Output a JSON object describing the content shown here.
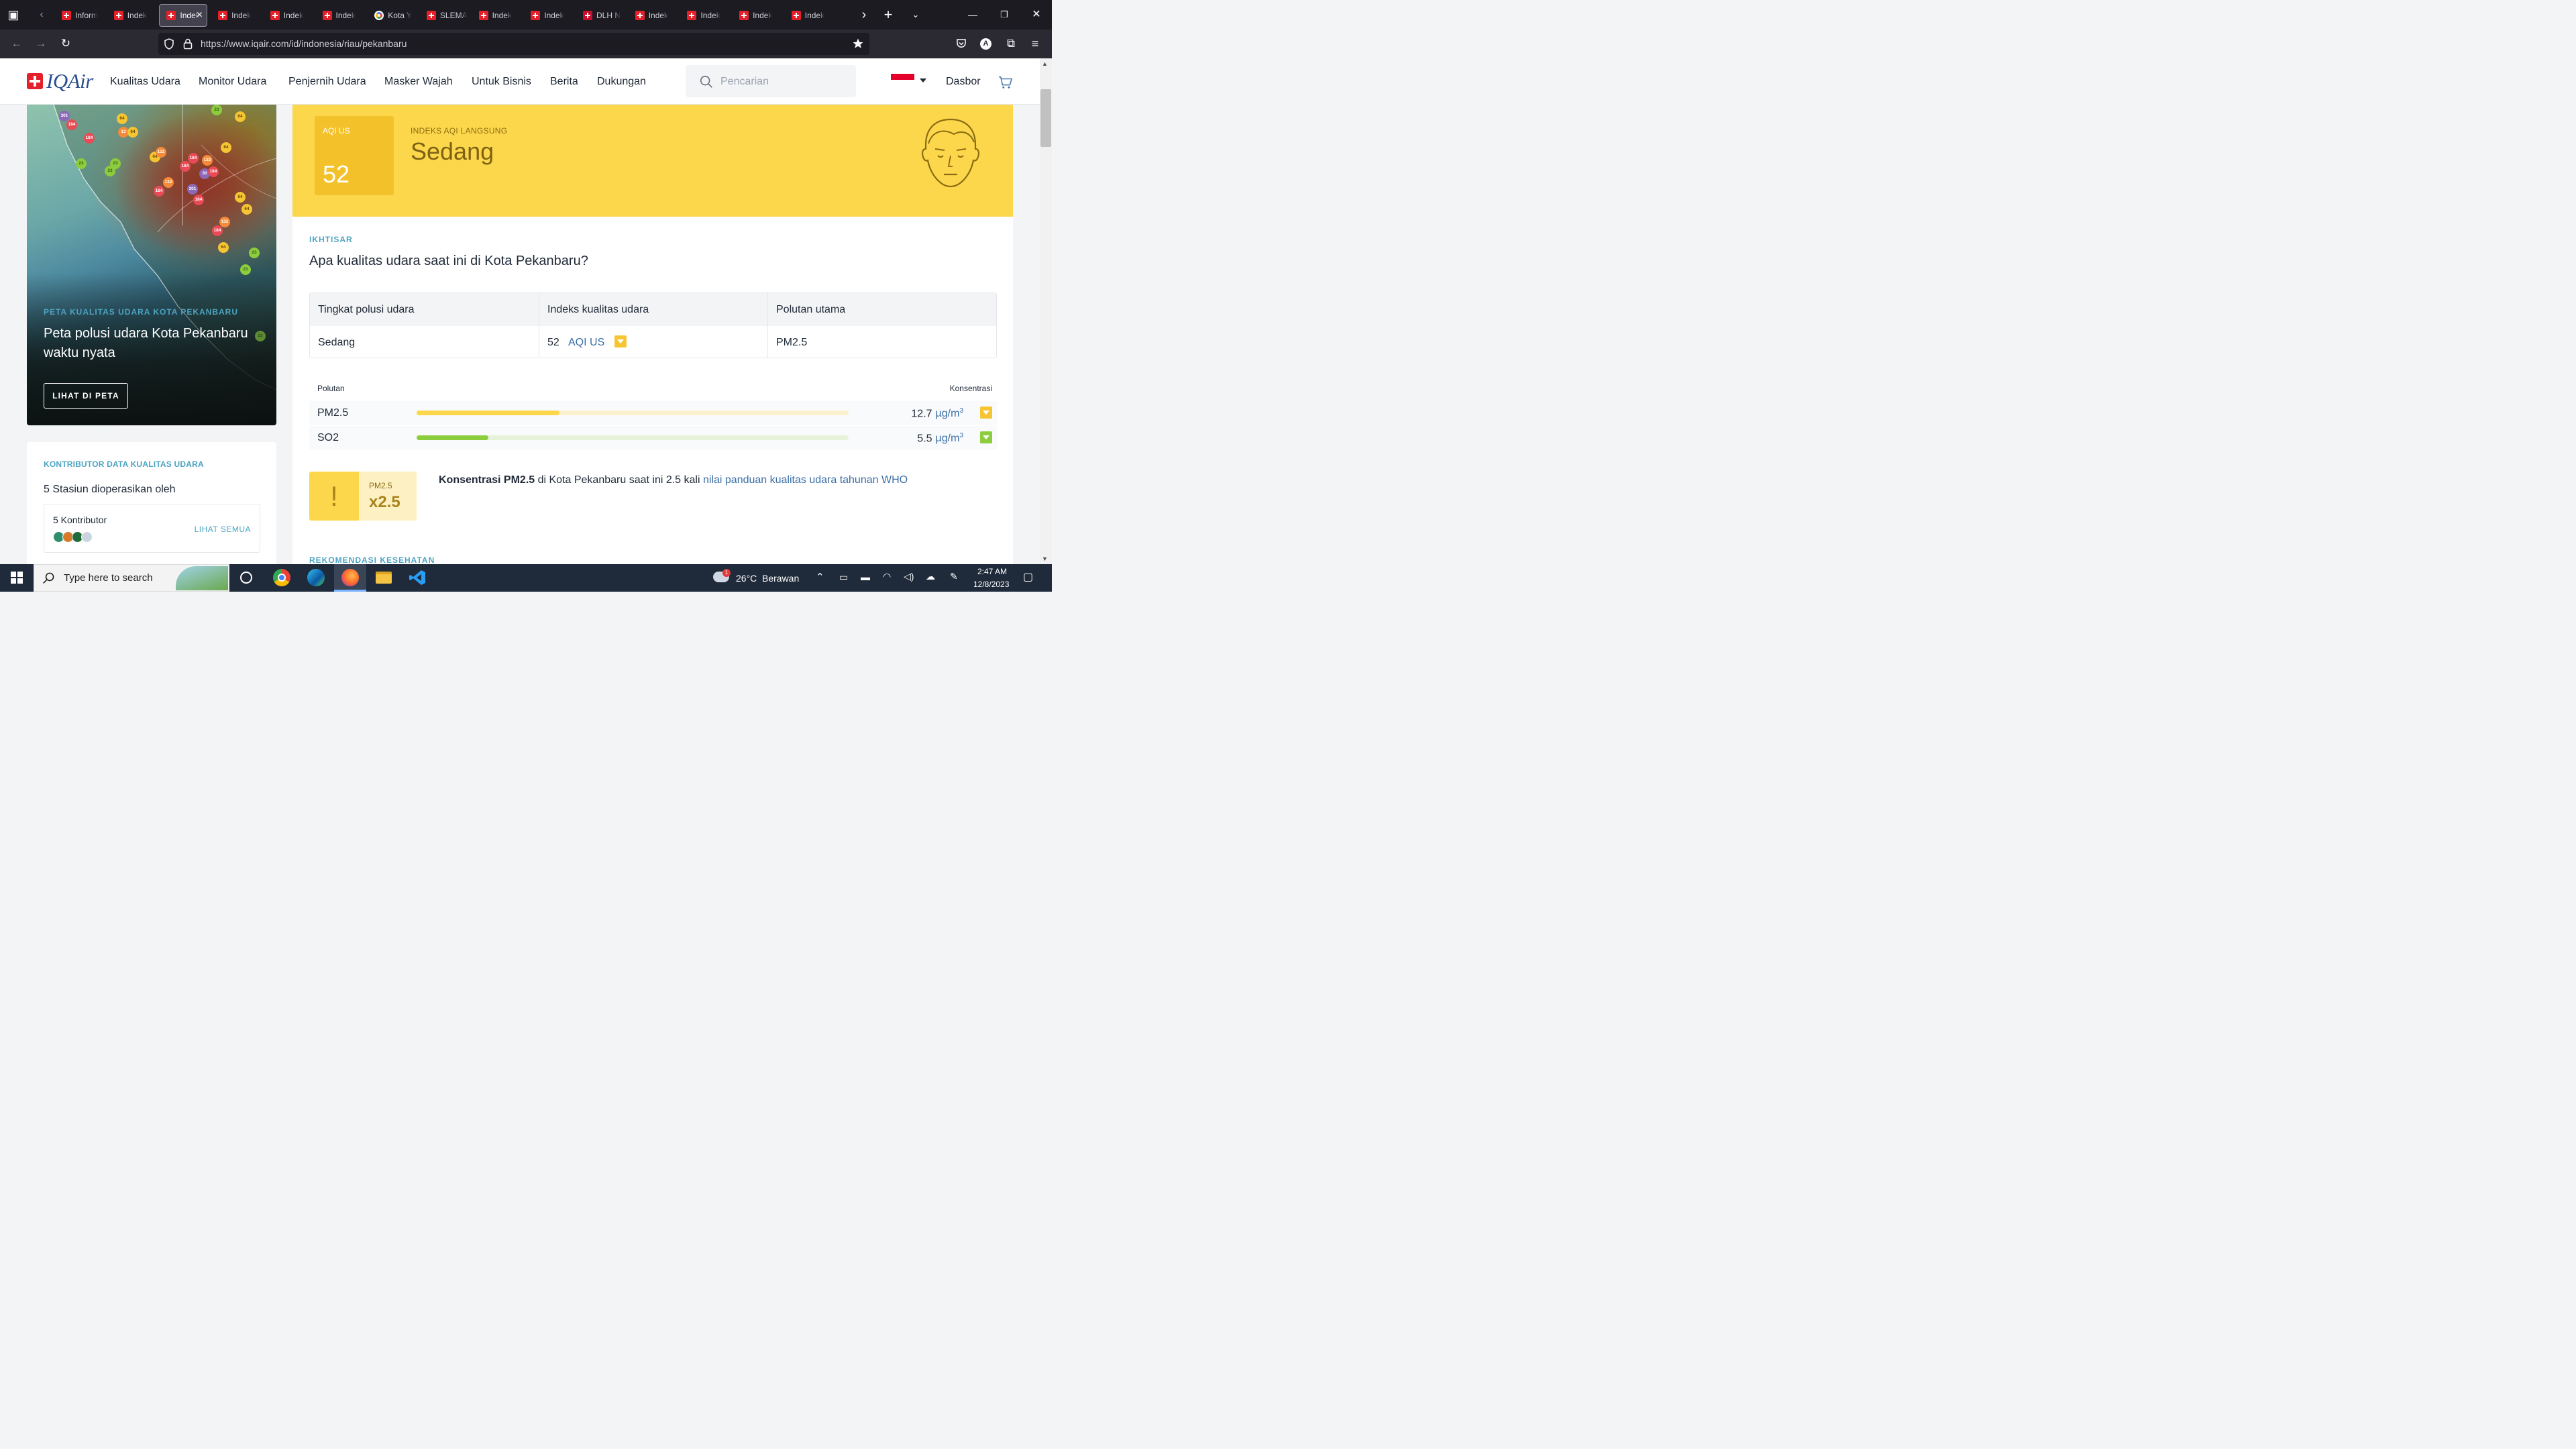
{
  "browser": {
    "tabs": [
      {
        "label": "Inform",
        "icon": "iqair-favicon"
      },
      {
        "label": "Indek",
        "icon": "iqair-favicon"
      },
      {
        "label": "Indek",
        "icon": "iqair-favicon",
        "active": true
      },
      {
        "label": "Indek",
        "icon": "iqair-favicon"
      },
      {
        "label": "Indek",
        "icon": "iqair-favicon"
      },
      {
        "label": "Indek",
        "icon": "iqair-favicon"
      },
      {
        "label": "Kota Y",
        "icon": "google-favicon"
      },
      {
        "label": "SLEMA",
        "icon": "iqair-favicon"
      },
      {
        "label": "Indek",
        "icon": "iqair-favicon"
      },
      {
        "label": "Indek",
        "icon": "iqair-favicon"
      },
      {
        "label": "DLH N",
        "icon": "dlh-favicon"
      },
      {
        "label": "Indek",
        "icon": "iqair-favicon"
      },
      {
        "label": "Indek",
        "icon": "iqair-favicon"
      },
      {
        "label": "Indek",
        "icon": "iqair-favicon"
      },
      {
        "label": "Indek",
        "icon": "iqair-favicon"
      }
    ],
    "url": "https://www.iqair.com/id/indonesia/riau/pekanbaru",
    "profile_initial": "A"
  },
  "site": {
    "logo_text": "IQAir",
    "nav": [
      "Kualitas Udara",
      "Monitor Udara",
      "Penjernih Udara",
      "Masker Wajah",
      "Untuk Bisnis",
      "Berita",
      "Dukungan"
    ],
    "search_placeholder": "Pencarian",
    "dashboard": "Dasbor"
  },
  "map_card": {
    "kicker": "PETA KUALITAS UDARA KOTA PEKANBARU",
    "title": "Peta polusi udara Kota Pekanbaru waktu nyata",
    "button": "LIHAT DI PETA",
    "markers": [
      "301",
      "184",
      "184",
      "64",
      "13",
      "64",
      "23",
      "64",
      "23",
      "23",
      "132",
      "64",
      "184",
      "184",
      "132",
      "64",
      "30",
      "184",
      "132",
      "184",
      "301",
      "184",
      "64",
      "64",
      "132",
      "184",
      "64",
      "23",
      "23",
      "23"
    ]
  },
  "contributors": {
    "kicker": "KONTRIBUTOR DATA KUALITAS UDARA",
    "operated_by": "5 Stasiun dioperasikan oleh",
    "count": "5 Kontributor",
    "see_all": "LIHAT SEMUA"
  },
  "aqi": {
    "label": "AQI US",
    "value": "52",
    "live_label": "INDEKS AQI LANGSUNG",
    "status": "Sedang",
    "color": "#fdd74b"
  },
  "overview": {
    "kicker": "IKHTISAR",
    "question": "Apa kualitas udara saat ini di Kota Pekanbaru?",
    "table": {
      "headers": [
        "Tingkat polusi udara",
        "Indeks kualitas udara",
        "Polutan utama"
      ],
      "level": "Sedang",
      "index_value": "52",
      "index_unit": "AQI US",
      "main_pollutant": "PM2.5"
    },
    "pollutant_header": "Polutan",
    "concentration_header": "Konsentrasi",
    "pollutants": [
      {
        "name": "PM2.5",
        "value": "12.7",
        "unit": "µg/m",
        "unit_exp": "3",
        "level": 0.33,
        "color": "#fdd74b",
        "track": "#fbf1cf"
      },
      {
        "name": "SO2",
        "value": "5.5",
        "unit": "µg/m",
        "unit_exp": "3",
        "level": 0.166,
        "color": "#8ccd3d",
        "track": "#e6f3d8"
      }
    ],
    "who": {
      "pollutant": "PM2.5",
      "multiplier": "x2.5",
      "text_bold": "Konsentrasi PM2.5",
      "text_mid": " di Kota Pekanbaru saat ini 2.5 kali ",
      "text_link": "nilai panduan kualitas udara tahunan WHO"
    },
    "next_kicker": "REKOMENDASI KESEHATAN"
  },
  "taskbar": {
    "search_placeholder": "Type here to search",
    "weather_temp": "26°C",
    "weather_text": "Berawan",
    "time": "2:47 AM",
    "date": "12/8/2023",
    "weather_badge": "1"
  }
}
